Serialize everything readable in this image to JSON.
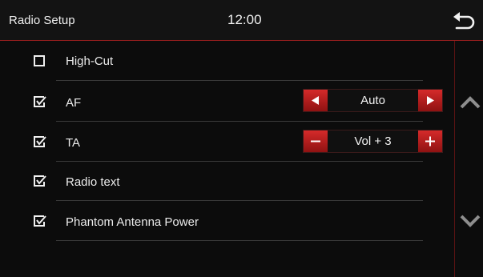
{
  "header": {
    "title": "Radio Setup",
    "time": "12:00",
    "back_icon": "back-arrow-icon"
  },
  "settings": [
    {
      "label": "High-Cut",
      "checked": false
    },
    {
      "label": "AF",
      "checked": true,
      "control": {
        "type": "arrows",
        "value": "Auto",
        "left_icon": "triangle-left-icon",
        "right_icon": "triangle-right-icon"
      }
    },
    {
      "label": "TA",
      "checked": true,
      "control": {
        "type": "stepper",
        "value": "Vol + 3",
        "left_icon": "minus-icon",
        "right_icon": "plus-icon"
      }
    },
    {
      "label": "Radio text",
      "checked": true
    },
    {
      "label": "Phantom Antenna Power",
      "checked": true
    }
  ],
  "scroll": {
    "up_icon": "chevron-up-icon",
    "down_icon": "chevron-down-icon"
  },
  "colors": {
    "accent": "#c41e1e",
    "background": "#0c0c0c",
    "text": "#ececec"
  }
}
